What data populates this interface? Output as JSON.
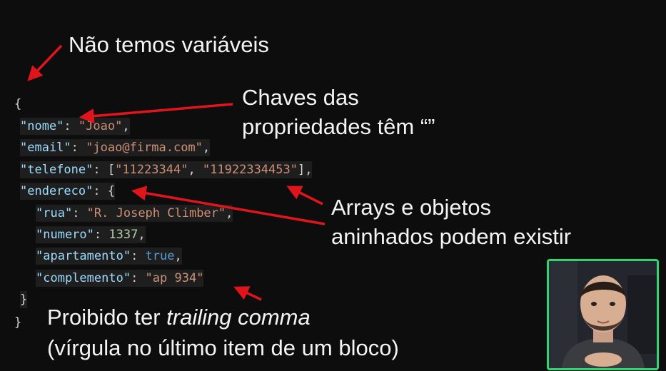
{
  "annotations": {
    "no_variables": "Não temos variáveis",
    "keys_line1": "Chaves das",
    "keys_line2": "propriedades têm “”",
    "arrays_line1": "Arrays e objetos",
    "arrays_line2": "aninhados podem existir",
    "trailing_prefix": "Proibido ter ",
    "trailing_italic": "trailing comma",
    "trailing_line2": "(vírgula no último item de um bloco)"
  },
  "code": {
    "open_brace": "{",
    "nome_key": "\"nome\"",
    "nome_val": "\"Joao\"",
    "email_key": "\"email\"",
    "email_val": "\"joao@firma.com\"",
    "telefone_key": "\"telefone\"",
    "telefone_val1": "\"11223344\"",
    "telefone_val2": "\"11922334453\"",
    "endereco_key": "\"endereco\"",
    "rua_key": "\"rua\"",
    "rua_val": "\"R. Joseph Climber\"",
    "numero_key": "\"numero\"",
    "numero_val": "1337",
    "apartamento_key": "\"apartamento\"",
    "apartamento_val": "true",
    "complemento_key": "\"complemento\"",
    "complemento_val": "\"ap 934\"",
    "inner_close": "}",
    "outer_close": "}"
  },
  "colors": {
    "arrow": "#e0151b",
    "webcam_border": "#2ed573",
    "key": "#9cdcfe",
    "string": "#ce9178",
    "number": "#b5cea8",
    "boolean": "#569cd6"
  },
  "icons": {
    "webcam": "presenter-webcam"
  }
}
